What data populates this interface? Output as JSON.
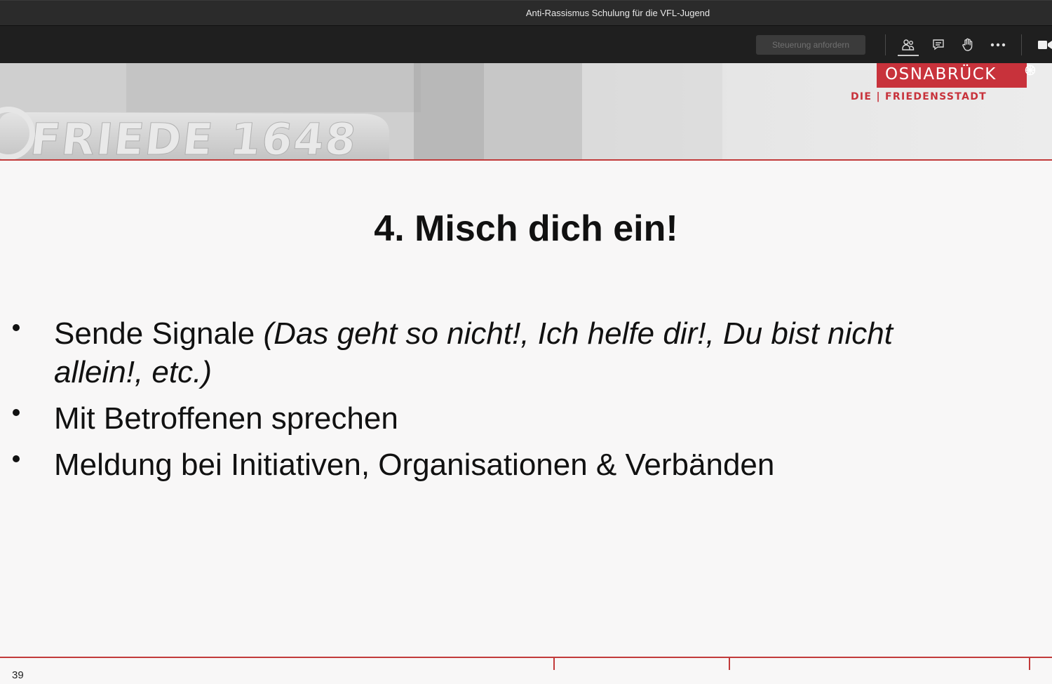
{
  "window": {
    "title": "Anti-Rassismus Schulung für die VFL-Jugend"
  },
  "toolbar": {
    "request_control_label": "Steuerung anfordern",
    "icons": [
      "people-icon",
      "chat-icon",
      "raise-hand-icon",
      "more-options-icon",
      "camera-icon"
    ]
  },
  "slide": {
    "banner": {
      "watermark_text": "FRIEDE 1648",
      "logo": "OSNABRÜCK",
      "logo_subtitle": "DIE | FRIEDENSSTADT"
    },
    "title": "4. Misch dich ein!",
    "bullets": [
      {
        "plain": "Sende Signale ",
        "italic": "(Das geht so nicht!, Ich helfe dir!, Du bist nicht allein!, etc.)"
      },
      {
        "plain": "Mit Betroffenen sprechen",
        "italic": ""
      },
      {
        "plain": "Meldung bei Initiativen, Organisationen & Verbänden",
        "italic": ""
      }
    ],
    "page_number": "39"
  },
  "colors": {
    "accent_red": "#c8323b",
    "toolbar_bg": "#1f1f1f",
    "slide_bg": "#f8f7f7"
  }
}
